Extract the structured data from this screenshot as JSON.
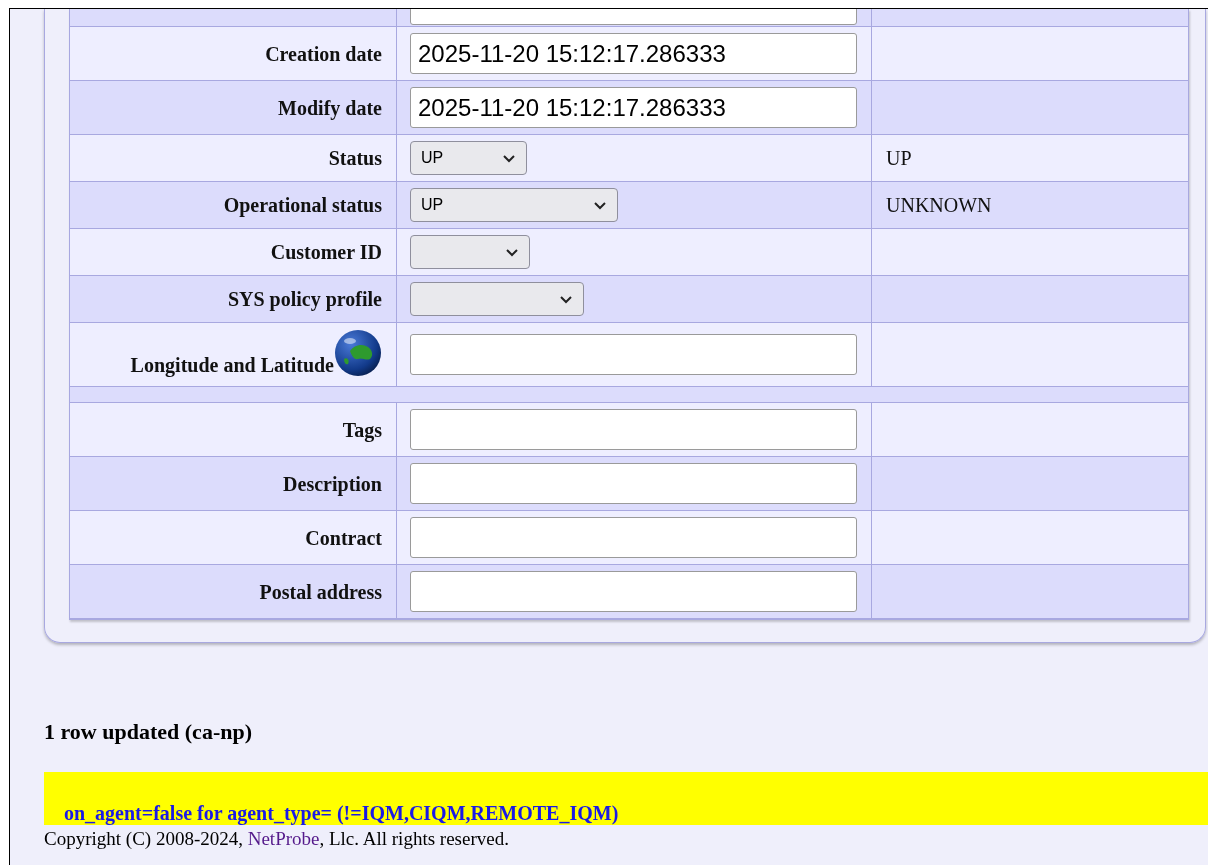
{
  "form_rows": [
    {
      "kind": "partial",
      "value": ""
    },
    {
      "kind": "text",
      "label": "Creation date",
      "value": "2025-11-20 15:12:17.286333"
    },
    {
      "kind": "text",
      "label": "Modify date",
      "value": "2025-11-20 15:12:17.286333"
    },
    {
      "kind": "select",
      "label": "Status",
      "value": "UP",
      "current": "UP"
    },
    {
      "kind": "select",
      "label": "Operational status",
      "value": "UP",
      "current": "UNKNOWN"
    },
    {
      "kind": "select",
      "label": "Customer ID"
    },
    {
      "kind": "select",
      "label": "SYS policy profile"
    },
    {
      "kind": "geo",
      "label": "Longitude and Latitude",
      "value": ""
    },
    {
      "kind": "spacer"
    },
    {
      "kind": "text",
      "label": "Tags",
      "value": ""
    },
    {
      "kind": "text",
      "label": "Description",
      "value": ""
    },
    {
      "kind": "text",
      "label": "Contract",
      "value": ""
    },
    {
      "kind": "text",
      "label": "Postal address",
      "value": ""
    }
  ],
  "result_message": "1 row updated (ca-np)",
  "warning": "on_agent=false for agent_type= (!=IQM,CIQM,REMOTE_IQM)",
  "footer": {
    "before": "Copyright (C) 2008-2024, ",
    "link": "NetProbe",
    "after": ", Llc. All rights reserved."
  }
}
